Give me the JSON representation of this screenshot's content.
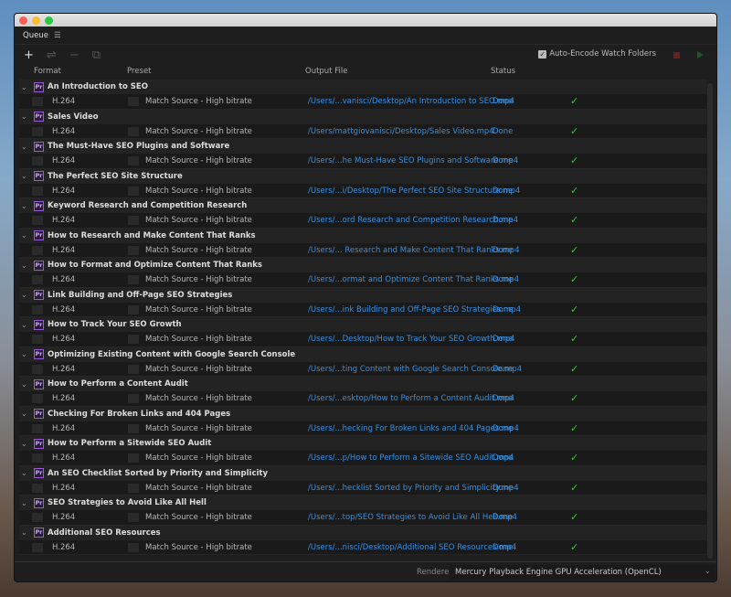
{
  "queue": {
    "title": "Queue",
    "menu_icon": "hamburger-icon"
  },
  "toolbar": {
    "auto_encode_label": "Auto-Encode Watch Folders",
    "auto_encode_checked": true
  },
  "columns": {
    "format": "Format",
    "preset": "Preset",
    "output": "Output File",
    "status": "Status"
  },
  "items": [
    {
      "name": "An Introduction to SEO",
      "format": "H.264",
      "preset": "Match Source - High bitrate",
      "output": "/Users/...vanisci/Desktop/An Introduction to SEO.mp4",
      "status": "Done"
    },
    {
      "name": "Sales Video",
      "format": "H.264",
      "preset": "Match Source - High bitrate",
      "output": "/Users/mattgiovanisci/Desktop/Sales Video.mp4",
      "status": "Done"
    },
    {
      "name": "The Must-Have SEO Plugins and Software",
      "format": "H.264",
      "preset": "Match Source - High bitrate",
      "output": "/Users/...he Must-Have SEO Plugins and Software.mp4",
      "status": "Done"
    },
    {
      "name": "The Perfect SEO Site Structure",
      "format": "H.264",
      "preset": "Match Source - High bitrate",
      "output": "/Users/...i/Desktop/The Perfect SEO Site Structure.mp4",
      "status": "Done"
    },
    {
      "name": "Keyword Research and Competition Research",
      "format": "H.264",
      "preset": "Match Source - High bitrate",
      "output": "/Users/...ord Research and Competition Research.mp4",
      "status": "Done"
    },
    {
      "name": "How to Research and Make Content That Ranks",
      "format": "H.264",
      "preset": "Match Source - High bitrate",
      "output": "/Users/... Research and Make Content That Ranks.mp4",
      "status": "Done"
    },
    {
      "name": "How to Format and Optimize Content That Ranks",
      "format": "H.264",
      "preset": "Match Source - High bitrate",
      "output": "/Users/...ormat and Optimize Content That Ranks.mp4",
      "status": "Done"
    },
    {
      "name": "Link Building and Off-Page SEO Strategies",
      "format": "H.264",
      "preset": "Match Source - High bitrate",
      "output": "/Users/...ink Building and Off-Page SEO Strategies.mp4",
      "status": "Done"
    },
    {
      "name": "How to Track Your SEO Growth",
      "format": "H.264",
      "preset": "Match Source - High bitrate",
      "output": "/Users/...Desktop/How to Track Your SEO Growth.mp4",
      "status": "Done"
    },
    {
      "name": "Optimizing Existing Content with Google Search Console",
      "format": "H.264",
      "preset": "Match Source - High bitrate",
      "output": "/Users/...ting Content with Google Search Console.mp4",
      "status": "Done"
    },
    {
      "name": "How to Perform a Content Audit",
      "format": "H.264",
      "preset": "Match Source - High bitrate",
      "output": "/Users/...esktop/How to Perform a Content Audit.mp4",
      "status": "Done"
    },
    {
      "name": "Checking For Broken Links and 404 Pages",
      "format": "H.264",
      "preset": "Match Source - High bitrate",
      "output": "/Users/...hecking For Broken Links and 404 Pages.mp4",
      "status": "Done"
    },
    {
      "name": "How to Perform a Sitewide SEO Audit",
      "format": "H.264",
      "preset": "Match Source - High bitrate",
      "output": "/Users/...p/How to Perform a Sitewide SEO Audit.mp4",
      "status": "Done"
    },
    {
      "name": "An SEO Checklist Sorted by Priority and Simplicity",
      "format": "H.264",
      "preset": "Match Source - High bitrate",
      "output": "/Users/...hecklist Sorted by Priority and Simplicity.mp4",
      "status": "Done"
    },
    {
      "name": "SEO Strategies to Avoid Like All Hell",
      "format": "H.264",
      "preset": "Match Source - High bitrate",
      "output": "/Users/...top/SEO Strategies to Avoid Like All Hell.mp4",
      "status": "Done"
    },
    {
      "name": "Additional SEO Resources",
      "format": "H.264",
      "preset": "Match Source - High bitrate",
      "output": "/Users/...nisci/Desktop/Additional SEO Resources.mp4",
      "status": "Done"
    }
  ],
  "app_badge": "Pr",
  "footer": {
    "renderer_label": "Renderer:",
    "renderer_value": "Mercury Playback Engine GPU Acceleration (OpenCL)"
  }
}
